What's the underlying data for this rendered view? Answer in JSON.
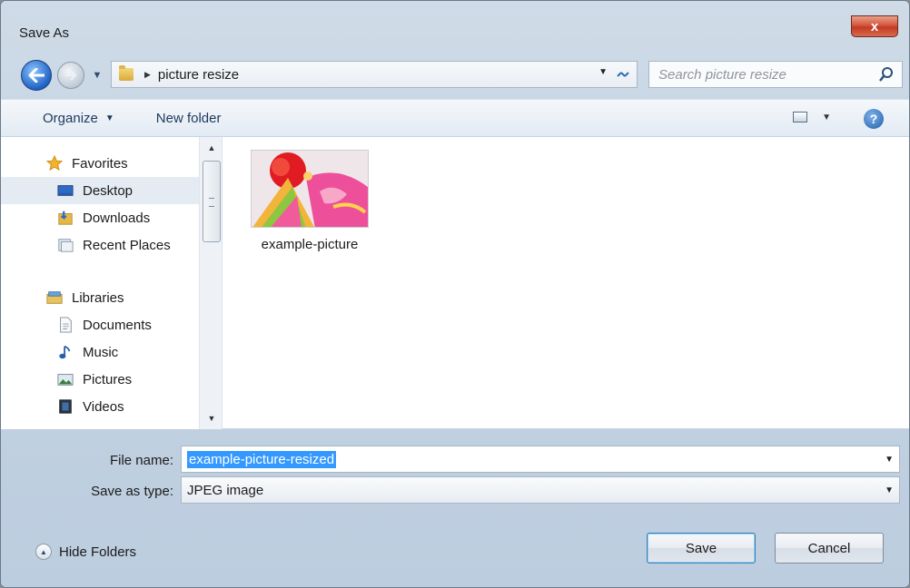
{
  "window": {
    "title": "Save As",
    "close_label": "x"
  },
  "address": {
    "crumb": "picture resize"
  },
  "search": {
    "placeholder": "Search picture resize"
  },
  "toolbar": {
    "organize_label": "Organize",
    "new_folder_label": "New folder",
    "help_label": "?"
  },
  "nav": {
    "favorites": {
      "label": "Favorites",
      "items": [
        {
          "label": "Desktop",
          "icon": "desktop-icon"
        },
        {
          "label": "Downloads",
          "icon": "downloads-icon"
        },
        {
          "label": "Recent Places",
          "icon": "recent-places-icon"
        }
      ]
    },
    "libraries": {
      "label": "Libraries",
      "items": [
        {
          "label": "Documents",
          "icon": "documents-icon"
        },
        {
          "label": "Music",
          "icon": "music-icon"
        },
        {
          "label": "Pictures",
          "icon": "pictures-icon"
        },
        {
          "label": "Videos",
          "icon": "videos-icon"
        }
      ]
    }
  },
  "files": [
    {
      "name": "example-picture"
    }
  ],
  "form": {
    "file_name_label": "File name:",
    "file_name_value": "example-picture-resized",
    "save_type_label": "Save as type:",
    "save_type_value": "JPEG image"
  },
  "footer": {
    "hide_folders_label": "Hide Folders",
    "save_label": "Save",
    "cancel_label": "Cancel"
  },
  "colors": {
    "selection": "#3399ff",
    "title_close": "#c23a22",
    "chrome": "#c4d3e2"
  }
}
